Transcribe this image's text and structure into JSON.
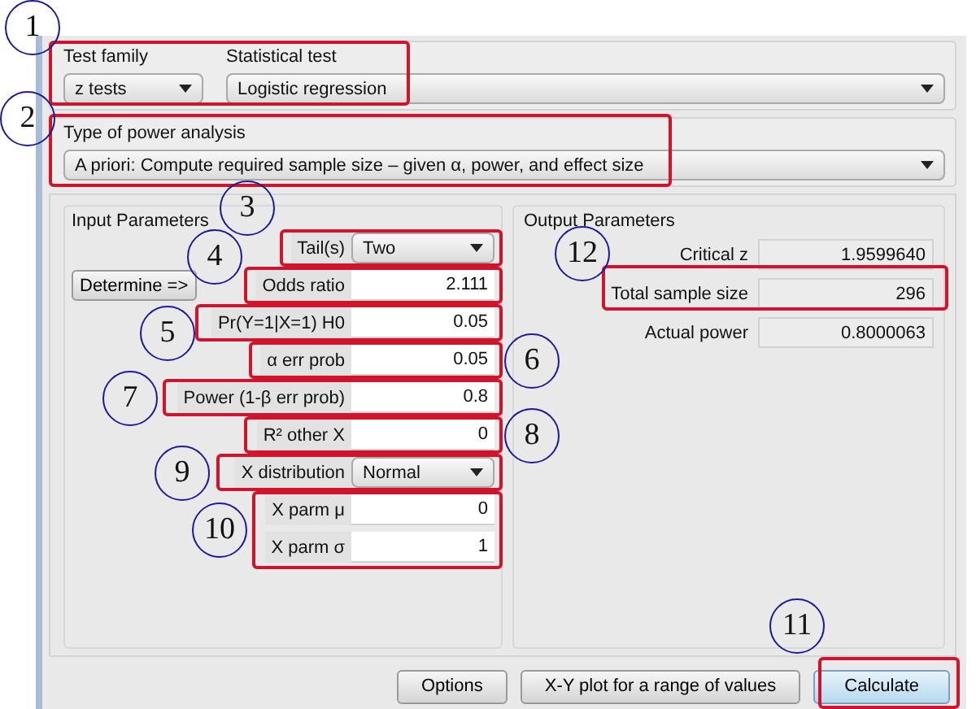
{
  "test_family": {
    "label": "Test family",
    "value": "z tests"
  },
  "statistical_test": {
    "label": "Statistical test",
    "value": "Logistic regression"
  },
  "power_analysis": {
    "label": "Type of power analysis",
    "value": "A priori: Compute required sample size – given α, power, and effect size"
  },
  "input_parameters": {
    "title": "Input Parameters",
    "determine_button": "Determine =>",
    "rows": [
      {
        "kind": "select",
        "label": "Tail(s)",
        "value": "Two"
      },
      {
        "kind": "field",
        "label": "Odds ratio",
        "value": "2.111"
      },
      {
        "kind": "field",
        "label": "Pr(Y=1|X=1) H0",
        "value": "0.05"
      },
      {
        "kind": "field",
        "label": "α err prob",
        "value": "0.05"
      },
      {
        "kind": "field",
        "label": "Power (1-β err prob)",
        "value": "0.8"
      },
      {
        "kind": "field",
        "label": "R² other X",
        "value": "0"
      },
      {
        "kind": "select",
        "label": "X distribution",
        "value": "Normal"
      },
      {
        "kind": "field",
        "label": "X parm μ",
        "value": "0"
      },
      {
        "kind": "field",
        "label": "X parm σ",
        "value": "1"
      }
    ]
  },
  "output_parameters": {
    "title": "Output Parameters",
    "rows": [
      {
        "label": "Critical z",
        "value": "1.9599640"
      },
      {
        "label": "Total sample size",
        "value": "296"
      },
      {
        "label": "Actual power",
        "value": "0.8000063"
      }
    ]
  },
  "buttons": [
    {
      "label": "Options",
      "primary": false
    },
    {
      "label": "X-Y plot for a range of values",
      "primary": false
    },
    {
      "label": "Calculate",
      "primary": true
    }
  ],
  "annotations": [
    {
      "number": "1"
    },
    {
      "number": "2"
    },
    {
      "number": "3"
    },
    {
      "number": "4"
    },
    {
      "number": "5"
    },
    {
      "number": "6"
    },
    {
      "number": "7"
    },
    {
      "number": "8"
    },
    {
      "number": "9"
    },
    {
      "number": "10"
    },
    {
      "number": "11"
    },
    {
      "number": "12"
    }
  ]
}
